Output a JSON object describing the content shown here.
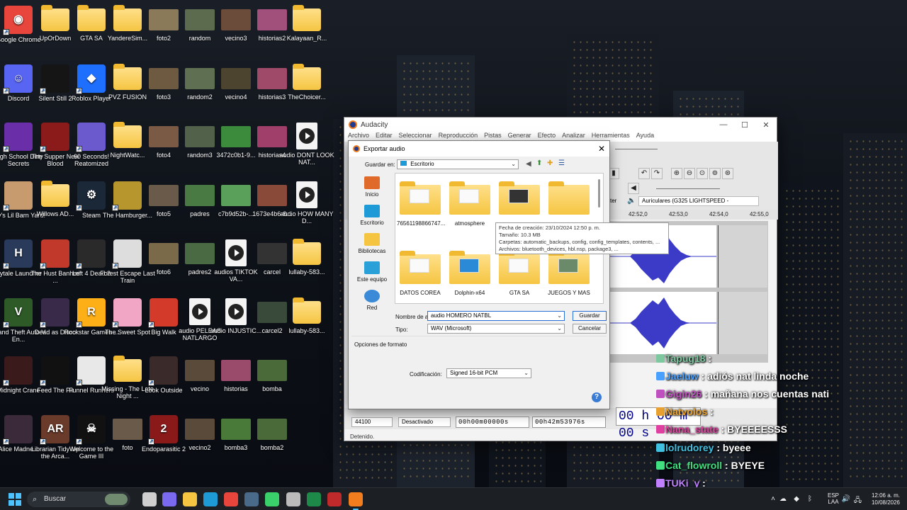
{
  "desktop": {
    "icons": [
      {
        "label": "Google Chrome",
        "kind": "app",
        "color": "#e8453c",
        "glyph": "◉",
        "shortcut": true
      },
      {
        "label": "UpOrDown",
        "kind": "folder"
      },
      {
        "label": "GTA SA",
        "kind": "folder"
      },
      {
        "label": "YandereSim...",
        "kind": "folder"
      },
      {
        "label": "foto2",
        "kind": "photo",
        "color": "#8a7a5a"
      },
      {
        "label": "random",
        "kind": "photo",
        "color": "#5c6b4e"
      },
      {
        "label": "vecino3",
        "kind": "photo",
        "color": "#6b4b3a"
      },
      {
        "label": "historias2",
        "kind": "photo",
        "color": "#a0507a"
      },
      {
        "label": "Kalayaan_R...",
        "kind": "folder"
      },
      {
        "label": "Discord",
        "kind": "app",
        "color": "#5865f2",
        "glyph": "☺",
        "shortcut": true
      },
      {
        "label": "Silent Still 2",
        "kind": "app",
        "color": "#151515",
        "glyph": "",
        "shortcut": true
      },
      {
        "label": "Roblox Player",
        "kind": "app",
        "color": "#1f6fff",
        "glyph": "◆",
        "shortcut": true
      },
      {
        "label": "PVZ FUSION",
        "kind": "folder"
      },
      {
        "label": "foto3",
        "kind": "photo",
        "color": "#6d5a40"
      },
      {
        "label": "random2",
        "kind": "photo",
        "color": "#5e6f52"
      },
      {
        "label": "vecino4",
        "kind": "photo",
        "color": "#4d4430"
      },
      {
        "label": "historias3",
        "kind": "photo",
        "color": "#a04a6a"
      },
      {
        "label": "TheChoicer...",
        "kind": "folder"
      },
      {
        "label": "High School Dirty Secrets",
        "kind": "app",
        "color": "#6a2fa8",
        "glyph": "",
        "shortcut": true
      },
      {
        "label": "The Supper New Blood",
        "kind": "app",
        "color": "#8b1a1a",
        "glyph": "",
        "shortcut": true
      },
      {
        "label": "60 Seconds! Reatomized",
        "kind": "app",
        "color": "#6a5acd",
        "glyph": "",
        "shortcut": true
      },
      {
        "label": "NightWatc...",
        "kind": "folder"
      },
      {
        "label": "foto4",
        "kind": "photo",
        "color": "#7a5a44"
      },
      {
        "label": "random3",
        "kind": "photo",
        "color": "#52624a"
      },
      {
        "label": "3472c0b1-9...",
        "kind": "photo",
        "color": "#3c8a3c"
      },
      {
        "label": "historias4",
        "kind": "photo",
        "color": "#a0406a"
      },
      {
        "label": "audio DONT LOOK NAT...",
        "kind": "media"
      },
      {
        "label": "Lily's Lil Barn Yard!",
        "kind": "app",
        "color": "#c89b6e",
        "glyph": "",
        "shortcut": true
      },
      {
        "label": "Willows AD...",
        "kind": "folder"
      },
      {
        "label": "Steam",
        "kind": "app",
        "color": "#1b2838",
        "glyph": "⚙",
        "shortcut": true
      },
      {
        "label": "The Hamburger...",
        "kind": "app",
        "color": "#b8962e",
        "glyph": "",
        "shortcut": true
      },
      {
        "label": "foto5",
        "kind": "photo",
        "color": "#6a5a4a"
      },
      {
        "label": "padres",
        "kind": "photo",
        "color": "#4a7a44"
      },
      {
        "label": "c7b9d52b-...",
        "kind": "photo",
        "color": "#5aa05a"
      },
      {
        "label": "1673e4b6-8...",
        "kind": "photo",
        "color": "#8a4a3a"
      },
      {
        "label": "audio HOW MANY D...",
        "kind": "media"
      },
      {
        "label": "Hytale Launcher",
        "kind": "app",
        "color": "#2a3a5a",
        "glyph": "H",
        "shortcut": true
      },
      {
        "label": "The Hust Banhmi ...",
        "kind": "app",
        "color": "#c0392b",
        "glyph": "",
        "shortcut": true
      },
      {
        "label": "Left 4 Dead 2",
        "kind": "app",
        "color": "#2a2a2a",
        "glyph": "",
        "shortcut": true
      },
      {
        "label": "Forest Escape Last Train",
        "kind": "app",
        "color": "#dddddd",
        "glyph": "",
        "shortcut": true
      },
      {
        "label": "foto6",
        "kind": "photo",
        "color": "#7a6a4a"
      },
      {
        "label": "padres2",
        "kind": "photo",
        "color": "#4a6a44"
      },
      {
        "label": "audios TIKTOK VA...",
        "kind": "media"
      },
      {
        "label": "carcel",
        "kind": "photo",
        "color": "#333333"
      },
      {
        "label": "lullaby-583...",
        "kind": "folder"
      },
      {
        "label": "Grand Theft Auto V En...",
        "kind": "app",
        "color": "#2d5a27",
        "glyph": "V",
        "shortcut": true
      },
      {
        "label": "Dead as Disco",
        "kind": "app",
        "color": "#3a2a4a",
        "glyph": "",
        "shortcut": true
      },
      {
        "label": "Rockstar Games ...",
        "kind": "app",
        "color": "#fcaf17",
        "glyph": "R",
        "shortcut": true
      },
      {
        "label": "The Sweet Spot",
        "kind": "app",
        "color": "#f2a6c6",
        "glyph": "",
        "shortcut": true
      },
      {
        "label": "Big Walk",
        "kind": "app",
        "color": "#d43a2a",
        "glyph": "",
        "shortcut": true
      },
      {
        "label": "audio PELEAS NATLARGO",
        "kind": "media"
      },
      {
        "label": "audio INJUSTIC...",
        "kind": "media"
      },
      {
        "label": "carcel2",
        "kind": "photo",
        "color": "#3a4a3a"
      },
      {
        "label": "lullaby-583...",
        "kind": "folder"
      },
      {
        "label": "Midnight Crane",
        "kind": "app",
        "color": "#3a1a1a",
        "glyph": "",
        "shortcut": true
      },
      {
        "label": "Feed The Pit",
        "kind": "app",
        "color": "#111111",
        "glyph": "",
        "shortcut": true
      },
      {
        "label": "Funnel Runners",
        "kind": "app",
        "color": "#e8e8e8",
        "glyph": "",
        "shortcut": true
      },
      {
        "label": "Missing - The Late Night ...",
        "kind": "folder"
      },
      {
        "label": "Look Outside",
        "kind": "app",
        "color": "#3a2a2a",
        "glyph": "",
        "shortcut": true
      },
      {
        "label": "vecino",
        "kind": "photo",
        "color": "#5a4a3a"
      },
      {
        "label": "historias",
        "kind": "photo",
        "color": "#9a4a6a"
      },
      {
        "label": "bomba",
        "kind": "photo",
        "color": "#4a6a3a"
      },
      {
        "label": "Alice Madne...",
        "kind": "app",
        "color": "#3a2a3a",
        "glyph": "",
        "shortcut": true
      },
      {
        "label": "Librarian Tidy Up the Arca...",
        "kind": "app",
        "color": "#6a3a2a",
        "glyph": "AR",
        "shortcut": true
      },
      {
        "label": "Welcome to the Game III",
        "kind": "app",
        "color": "#111111",
        "glyph": "☠",
        "shortcut": true
      },
      {
        "label": "foto",
        "kind": "photo",
        "color": "#6a5a4a"
      },
      {
        "label": "Endoparasitic 2",
        "kind": "app",
        "color": "#8a1a1a",
        "glyph": "2",
        "shortcut": true
      },
      {
        "label": "vecino2",
        "kind": "photo",
        "color": "#5a4a3a"
      },
      {
        "label": "bomba3",
        "kind": "photo",
        "color": "#4a7a3a"
      },
      {
        "label": "bomba2",
        "kind": "photo",
        "color": "#4a6a3a"
      }
    ]
  },
  "audacity": {
    "title": "Audacity",
    "window_controls": [
      "—",
      "☐",
      "✕"
    ],
    "menu": [
      "Archivo",
      "Editar",
      "Seleccionar",
      "Reproducción",
      "Pistas",
      "Generar",
      "Efecto",
      "Analizar",
      "Herramientas",
      "Ayuda"
    ],
    "device_partial": "ter",
    "output_device": "Auriculares (G325 LIGHTSPEED -",
    "ruler": [
      "42:52,0",
      "42:53,0",
      "42:54,0",
      "42:55,0"
    ],
    "rate": "44100",
    "snap": "Desactivado",
    "time_start": "00h00m00000s",
    "time_end": "00h42m53976s",
    "big_time": "00 h 00 m 00 s",
    "status": "Detenido.",
    "wave_color": "#3b3bc8"
  },
  "export": {
    "title": "Exportar audio",
    "save_in_label": "Guardar en:",
    "save_in_value": "Escritorio",
    "places": [
      {
        "label": "Inicio",
        "color": "#e06a2a"
      },
      {
        "label": "Escritorio",
        "color": "#1e9bd7"
      },
      {
        "label": "Bibliotecas",
        "color": "#f5c542"
      },
      {
        "label": "Este equipo",
        "color": "#2aa0d8"
      },
      {
        "label": "Red",
        "color": "#3a8ad8"
      }
    ],
    "files": [
      {
        "name": "76561198866747..."
      },
      {
        "name": "atmosphere"
      },
      {
        "name": ""
      },
      {
        "name": ""
      },
      {
        "name": "DATOS COREA"
      },
      {
        "name": "Dolphin-x64"
      },
      {
        "name": "GTA SA"
      },
      {
        "name": "JUEGOS Y MAS"
      }
    ],
    "tooltip": {
      "line1": "Fecha de creación: 23/10/2024 12:50 p. m.",
      "line2": "Tamaño: 10.3 MB",
      "line3": "Carpetas: automatic_backups, config, config_templates, contents, ...",
      "line4": "Archivos: bluetooth_devices, hbl.nsp, package3, ..."
    },
    "filename_label": "Nombre de ar",
    "filename_value": "audio HOMERO NATBL",
    "type_label": "Tipo:",
    "type_value": "WAV (Microsoft)",
    "save_button": "Guardar",
    "cancel_button": "Cancelar",
    "format_options_label": "Opciones de formato",
    "encoding_label": "Codificación:",
    "encoding_value": "Signed 16-bit PCM",
    "help": "?"
  },
  "chat": [
    {
      "user": "Tapug18",
      "message": "",
      "color": "#7ec8a0"
    },
    {
      "user": "Jaeluw",
      "message": "adiós nat linda noche",
      "color": "#4aa0ff"
    },
    {
      "user": "Gigin26",
      "message": "mañana nos cuentas nati",
      "color": "#c050c0"
    },
    {
      "user": "Natvolos",
      "message": "",
      "color": "#e8a030"
    },
    {
      "user": "Nana_state",
      "message": "BYEEEESSS",
      "color": "#e040a0"
    },
    {
      "user": "lolrudorey",
      "message": "byeee",
      "color": "#40c0e0"
    },
    {
      "user": "Cat_flowroll",
      "message": "BYEYE",
      "color": "#40e080"
    },
    {
      "user": "TUKi_y",
      "message": "",
      "color": "#c080ff"
    }
  ],
  "taskbar": {
    "search_placeholder": "Buscar",
    "apps": [
      {
        "name": "task-view",
        "color": "#cfcfcf"
      },
      {
        "name": "copilot",
        "color": "#7a6af0"
      },
      {
        "name": "explorer",
        "color": "#f5c542"
      },
      {
        "name": "edge",
        "color": "#1e9bd7"
      },
      {
        "name": "chrome",
        "color": "#e8453c"
      },
      {
        "name": "steam",
        "color": "#4a6a8a"
      },
      {
        "name": "app-green",
        "color": "#3ad06a"
      },
      {
        "name": "app-gray",
        "color": "#bbbbbb"
      },
      {
        "name": "app-x",
        "color": "#1e8a4a"
      },
      {
        "name": "app-v",
        "color": "#c02a2a"
      },
      {
        "name": "audacity",
        "color": "#f27d1f"
      }
    ],
    "language": "ESP",
    "language_sub": "LAA",
    "time": "12:06 a. m.",
    "date": "10/08/2026"
  }
}
